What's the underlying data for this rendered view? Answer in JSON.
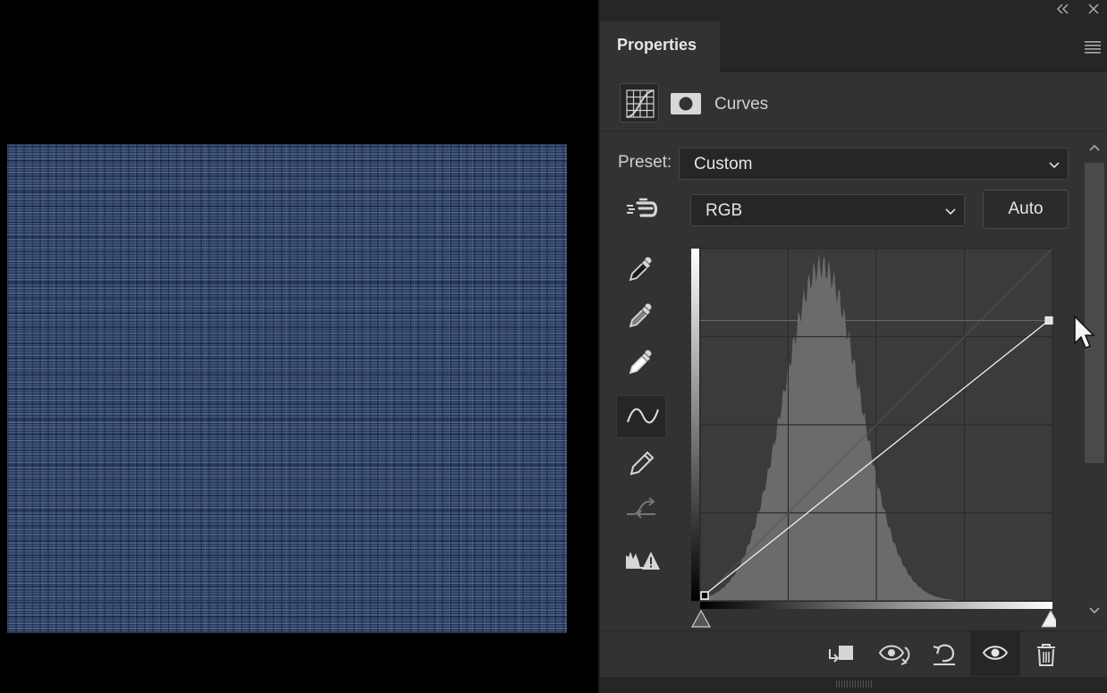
{
  "panel": {
    "tab_title": "Properties",
    "adjustment_name": "Curves",
    "preset_label": "Preset:",
    "preset_value": "Custom",
    "channel_value": "RGB",
    "auto_label": "Auto"
  },
  "icons": {
    "collapse": "collapse-double-chevron-icon",
    "close": "close-icon",
    "panel_menu": "hamburger-menu-icon",
    "adjustment_type": "curves-adjustment-icon",
    "mask": "layer-mask-icon",
    "on_image": "targeted-adjustment-hand-icon",
    "black_point": "black-eyedropper-icon",
    "gray_point": "gray-eyedropper-icon",
    "white_point": "white-eyedropper-icon",
    "edit_points": "curve-point-tool-icon",
    "draw": "pencil-icon",
    "smooth": "smooth-curve-icon",
    "clipping": "clipping-warning-icon",
    "clip_to_layer": "clip-to-layer-icon",
    "view_previous": "view-previous-state-icon",
    "reset": "reset-icon",
    "visibility": "eye-icon",
    "delete": "trash-icon"
  },
  "curve": {
    "input_range": [
      0,
      255
    ],
    "output_range": [
      0,
      255
    ],
    "points": [
      [
        0,
        0
      ],
      [
        255,
        203
      ]
    ],
    "histogram_peak_input": 88,
    "black_slider": 0,
    "white_slider": 255
  },
  "colors": {
    "panel_bg": "#323232",
    "canvas_bg": "#000000",
    "image_tint": "#3b5378"
  }
}
